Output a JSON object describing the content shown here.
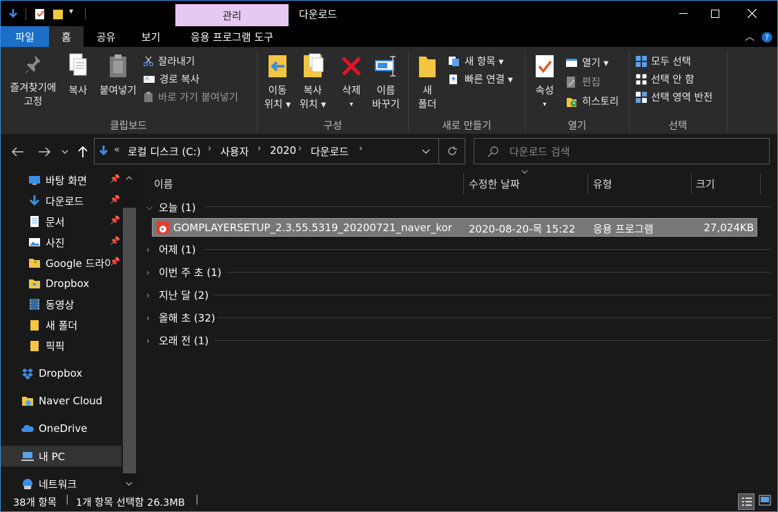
{
  "window": {
    "title": "다운로드",
    "context_tab": "관리",
    "controls": {
      "minimize": "—",
      "maximize": "☐",
      "close": "✕"
    }
  },
  "ribbon_tabs": {
    "file": "파일",
    "home": "홈",
    "share": "공유",
    "view": "보기",
    "app_tools": "응용 프로그램 도구"
  },
  "ribbon": {
    "clipboard": {
      "pin": [
        "즐겨찾기에",
        "고정"
      ],
      "copy": "복사",
      "paste": "붙여넣기",
      "cut": "잘라내기",
      "copy_path": "경로 복사",
      "paste_shortcut": "바로 가기 붙여넣기",
      "group": "클립보드"
    },
    "organize": {
      "move_to": [
        "이동",
        "위치 ▾"
      ],
      "copy_to": [
        "복사",
        "위치 ▾"
      ],
      "delete": [
        "삭제",
        "▾"
      ],
      "rename": [
        "이름",
        "바꾸기"
      ],
      "group": "구성"
    },
    "new": {
      "new_folder": [
        "새",
        "폴더"
      ],
      "new_item": "새 항목 ▾",
      "easy_access": "빠른 연결 ▾",
      "group": "새로 만들기"
    },
    "open": {
      "properties": [
        "속성",
        "▾"
      ],
      "open": "열기 ▾",
      "edit": "편집",
      "history": "히스토리",
      "group": "열기"
    },
    "select": {
      "select_all": "모두 선택",
      "select_none": "선택 안 함",
      "invert": "선택 영역 반전",
      "group": "선택"
    }
  },
  "address": {
    "prefix": "«",
    "crumbs": [
      "로컬 디스크 (C:)",
      "사용자",
      "2020",
      "다운로드"
    ],
    "search_placeholder": "다운로드 검색"
  },
  "sidebar": {
    "quick": [
      {
        "label": "바탕 화면",
        "icon": "desktop-icon",
        "pinned": true
      },
      {
        "label": "다운로드",
        "icon": "download-icon",
        "pinned": true
      },
      {
        "label": "문서",
        "icon": "document-icon",
        "pinned": true
      },
      {
        "label": "사진",
        "icon": "pictures-icon",
        "pinned": true
      },
      {
        "label": "Google 드라이브",
        "icon": "google-drive-folder-icon",
        "pinned": true
      },
      {
        "label": "Dropbox",
        "icon": "dropbox-folder-icon",
        "pinned": false
      },
      {
        "label": "동영상",
        "icon": "videos-icon",
        "pinned": false
      },
      {
        "label": "새 폴더",
        "icon": "folder-icon",
        "pinned": false
      },
      {
        "label": "픽픽",
        "icon": "folder-icon",
        "pinned": false
      }
    ],
    "roots": [
      {
        "label": "Dropbox",
        "icon": "dropbox-icon"
      },
      {
        "label": "Naver Cloud",
        "icon": "naver-cloud-icon"
      },
      {
        "label": "OneDrive",
        "icon": "onedrive-icon"
      },
      {
        "label": "내 PC",
        "icon": "this-pc-icon"
      },
      {
        "label": "네트워크",
        "icon": "network-icon"
      }
    ]
  },
  "columns": {
    "name": "이름",
    "modified": "수정한 날짜",
    "type": "유형",
    "size": "크기"
  },
  "groups": [
    {
      "label": "오늘 (1)",
      "expanded": true
    },
    {
      "label": "어제 (1)",
      "expanded": false
    },
    {
      "label": "이번 주 초 (1)",
      "expanded": false
    },
    {
      "label": "지난 달 (2)",
      "expanded": false
    },
    {
      "label": "올해 초 (32)",
      "expanded": false
    },
    {
      "label": "오래 전 (1)",
      "expanded": false
    }
  ],
  "files": [
    {
      "name": "GOMPLAYERSETUP_2.3.55.5319_20200721_naver_kor",
      "modified": "2020-08-20-목 15:22",
      "type": "응용 프로그램",
      "size": "27,024KB",
      "icon_text": "GOM",
      "selected": true
    }
  ],
  "status": {
    "count": "38개 항목",
    "selection": "1개 항목 선택함 26.3MB"
  },
  "colors": {
    "accent": "#1a6fc9",
    "context_tab": "#e6c8f2",
    "folder": "#f4c542",
    "delete": "#e81123",
    "selection": "#777777"
  }
}
